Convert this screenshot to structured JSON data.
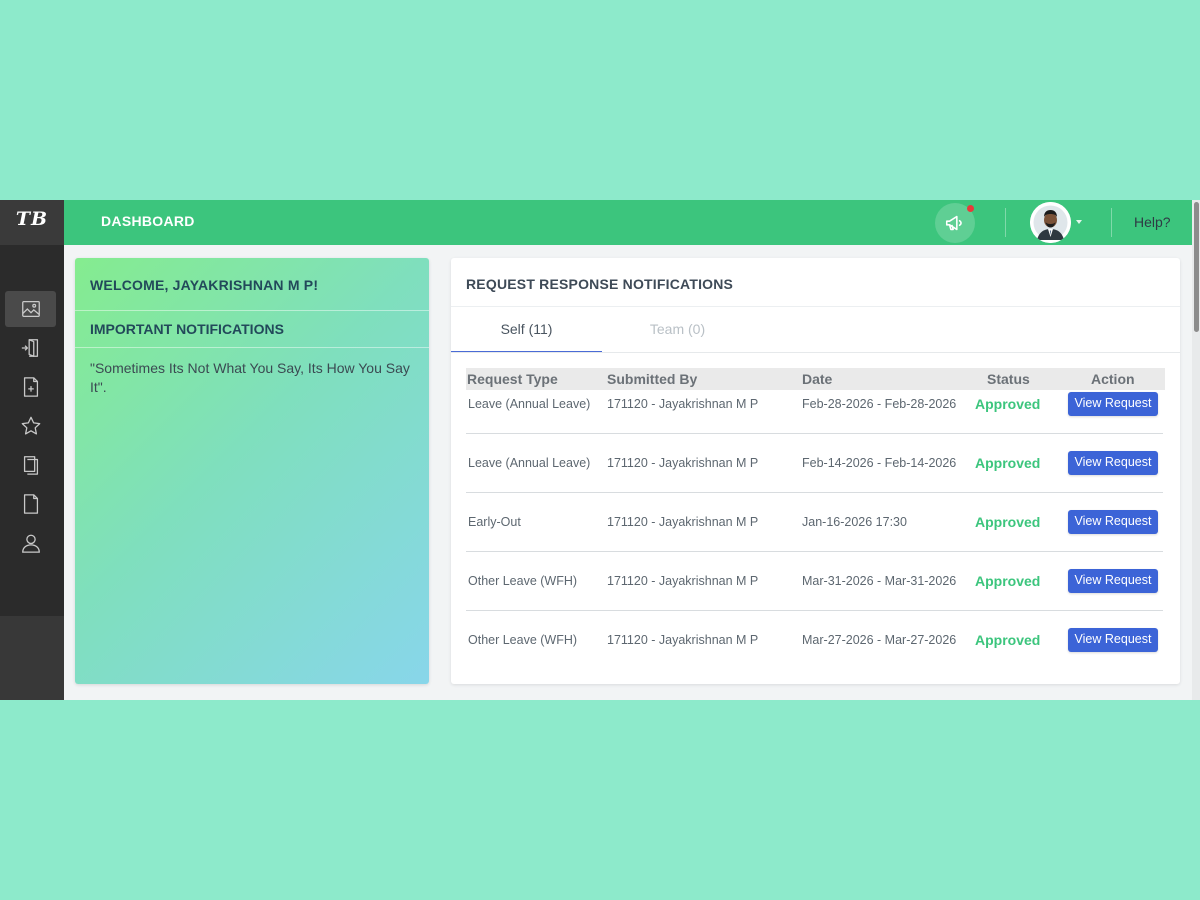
{
  "app": {
    "brand": "TB",
    "nav_label": "DASHBOARD",
    "help_label": "Help?"
  },
  "sidebar": {
    "items": [
      {
        "icon": "image-icon",
        "active": true
      },
      {
        "icon": "door-exit-icon",
        "active": false
      },
      {
        "icon": "file-add-icon",
        "active": false
      },
      {
        "icon": "star-icon",
        "active": false
      },
      {
        "icon": "book-icon",
        "active": false
      },
      {
        "icon": "document-icon",
        "active": false
      },
      {
        "icon": "user-icon",
        "active": false
      }
    ]
  },
  "welcome": {
    "title": "WELCOME, JAYAKRISHNAN M P!",
    "important_title": "IMPORTANT NOTIFICATIONS",
    "quote": "\"Sometimes Its Not What You Say, Its How You Say It\"."
  },
  "notifications": {
    "title": "REQUEST RESPONSE NOTIFICATIONS",
    "tabs": [
      {
        "label": "Self (11)",
        "active": true
      },
      {
        "label": "Team (0)",
        "active": false
      }
    ],
    "columns": {
      "type": "Request Type",
      "by": "Submitted By",
      "date": "Date",
      "status": "Status",
      "action": "Action"
    },
    "rows": [
      {
        "type": "Leave (Annual Leave)",
        "by": "171120 - Jayakrishnan M P",
        "date": "Feb-28-2026 - Feb-28-2026",
        "status": "Approved",
        "action": "View Request"
      },
      {
        "type": "Leave (Annual Leave)",
        "by": "171120 - Jayakrishnan M P",
        "date": "Feb-14-2026 - Feb-14-2026",
        "status": "Approved",
        "action": "View Request"
      },
      {
        "type": "Early-Out",
        "by": "171120 - Jayakrishnan M P",
        "date": "Jan-16-2026 17:30",
        "status": "Approved",
        "action": "View Request"
      },
      {
        "type": "Other Leave (WFH)",
        "by": "171120 - Jayakrishnan M P",
        "date": "Mar-31-2026 - Mar-31-2026",
        "status": "Approved",
        "action": "View Request"
      },
      {
        "type": "Other Leave (WFH)",
        "by": "171120 - Jayakrishnan M P",
        "date": "Mar-27-2026 - Mar-27-2026",
        "status": "Approved",
        "action": "View Request"
      }
    ]
  },
  "colors": {
    "topbar": "#3cc57d",
    "sidebar": "#2b2b2b",
    "approved": "#3cc57d",
    "button": "#3c64d7",
    "notification_dot": "#e83a3a"
  }
}
